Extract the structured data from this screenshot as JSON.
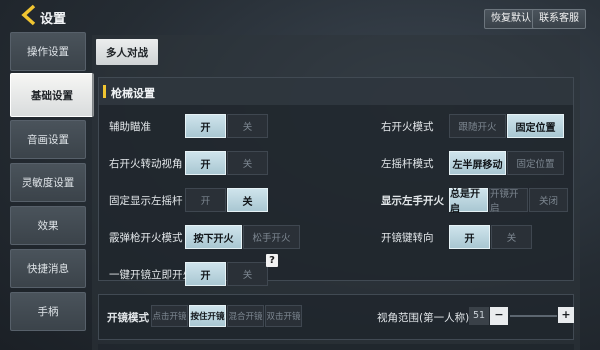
{
  "header": {
    "title": "设置",
    "restore_default": "恢复默认",
    "contact_service": "联系客服"
  },
  "sidebar": {
    "items": [
      {
        "label": "操作设置",
        "active": false
      },
      {
        "label": "基础设置",
        "active": true
      },
      {
        "label": "音画设置",
        "active": false
      },
      {
        "label": "灵敏度设置",
        "active": false
      },
      {
        "label": "效果",
        "active": false
      },
      {
        "label": "快捷消息",
        "active": false
      },
      {
        "label": "手柄",
        "active": false
      }
    ]
  },
  "tabs": {
    "multiplayer": "多人对战"
  },
  "gun_settings": {
    "title": "枪械设置",
    "aim_assist": {
      "label": "辅助瞄准",
      "on": "开",
      "off": "关",
      "selected": "开"
    },
    "right_fire_rotate": {
      "label": "右开火转动视角",
      "on": "开",
      "off": "关",
      "selected": "开"
    },
    "fixed_left_stick": {
      "label": "固定显示左摇杆",
      "on": "开",
      "off": "关",
      "selected": "关"
    },
    "shotgun_fire_mode": {
      "label": "霰弹枪开火模式",
      "opt1": "按下开火",
      "opt2": "松手开火",
      "selected": "按下开火"
    },
    "one_tap_scope_fire": {
      "label": "一键开镜立即开火",
      "on": "开",
      "off": "关",
      "selected": "开"
    },
    "help_icon": "?",
    "right_fire_mode": {
      "label": "右开火模式",
      "opt1": "跟随开火",
      "opt2": "固定位置",
      "selected": "固定位置"
    },
    "left_stick_mode": {
      "label": "左摇杆模式",
      "opt1": "左半屏移动",
      "opt2": "固定位置",
      "selected": "左半屏移动"
    },
    "show_left_fire": {
      "label": "显示左手开火",
      "opt1": "总是开启",
      "opt2": "开镜开启",
      "opt3": "关闭",
      "selected": "总是开启"
    },
    "scope_turn": {
      "label": "开镜键转向",
      "on": "开",
      "off": "关",
      "selected": "开"
    }
  },
  "scope_row": {
    "label": "开镜模式",
    "opt1": "点击开镜",
    "opt2": "按住开镜",
    "opt3": "混合开镜",
    "opt4": "双击开镜",
    "selected": "按住开镜",
    "fov_label": "视角范围(第一人称)",
    "fov_value": "51",
    "minus": "−",
    "plus": "+"
  },
  "colors": {
    "accent_yellow": "#f1c531",
    "selected_option": "#bcd6df"
  }
}
